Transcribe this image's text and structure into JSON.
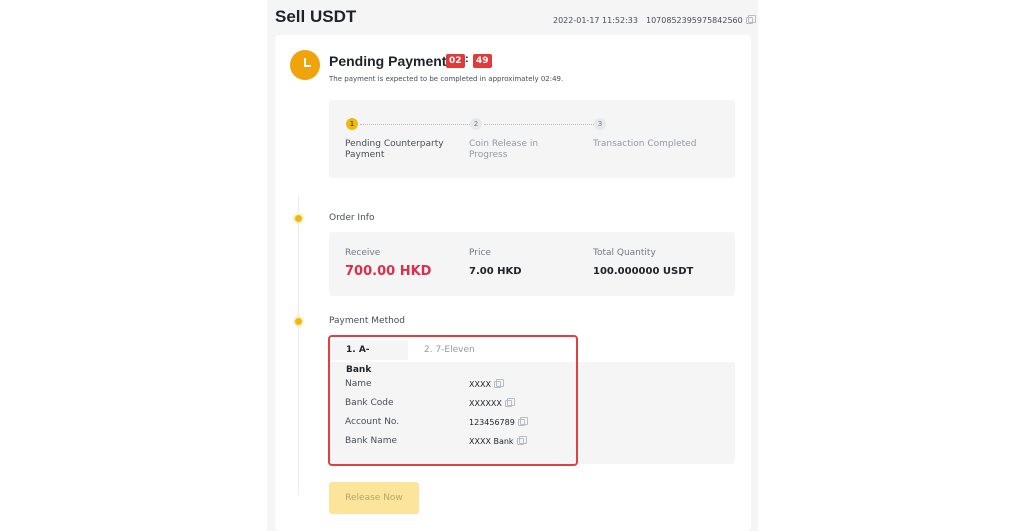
{
  "header": {
    "title": "Sell USDT",
    "date": "2022-01-17 11:52:33",
    "order_number": "1070852395975842560"
  },
  "status": {
    "title": "Pending Payment",
    "timer_minutes": "02",
    "timer_seconds": "49",
    "timer_separator": ":",
    "description": "The payment is expected to be completed in approximately 02:49."
  },
  "steps": [
    {
      "number": "1",
      "label": "Pending Counterparty Payment",
      "active": true
    },
    {
      "number": "2",
      "label": "Coin Release in Progress",
      "active": false
    },
    {
      "number": "3",
      "label": "Transaction Completed",
      "active": false
    }
  ],
  "order_info": {
    "section_label": "Order Info",
    "receive_label": "Receive",
    "receive_value": "700.00 HKD",
    "price_label": "Price",
    "price_value": "7.00 HKD",
    "quantity_label": "Total Quantity",
    "quantity_value": "100.000000 USDT"
  },
  "payment_method": {
    "section_label": "Payment Method",
    "tabs": [
      {
        "label": "1. A-Bank",
        "active": true
      },
      {
        "label": "2. 7-Eleven",
        "active": false
      }
    ],
    "fields": [
      {
        "label": "Name",
        "value": "XXXX"
      },
      {
        "label": "Bank Code",
        "value": "XXXXXX"
      },
      {
        "label": "Account No.",
        "value": "123456789"
      },
      {
        "label": "Bank Name",
        "value": "XXXX Bank"
      }
    ]
  },
  "actions": {
    "release_label": "Release Now"
  },
  "colors": {
    "accent": "#f0b90b",
    "timer_red": "#e03a3a",
    "receive_red": "#d9304e",
    "highlight_red": "#e04040"
  }
}
